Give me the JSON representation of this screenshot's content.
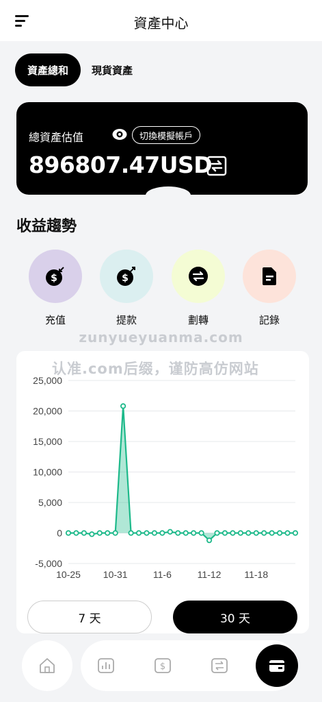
{
  "header": {
    "title": "資產中心",
    "menu_icon": "menu-icon"
  },
  "tabs": [
    {
      "label": "資產總和",
      "active": true
    },
    {
      "label": "現貨資產",
      "active": false
    }
  ],
  "asset": {
    "label": "總資產估值",
    "switch_label": "切換模擬帳戶",
    "value": "896807.47USD"
  },
  "section_title": "收益趨勢",
  "actions": [
    {
      "label": "充值",
      "icon": "deposit-icon",
      "color": "#d9d0ea"
    },
    {
      "label": "提款",
      "icon": "withdraw-icon",
      "color": "#dbeff0"
    },
    {
      "label": "劃轉",
      "icon": "transfer-icon",
      "color": "#f4fcd4"
    },
    {
      "label": "記錄",
      "icon": "record-icon",
      "color": "#fde3da"
    }
  ],
  "watermarks": {
    "site": "zunyueyuanma.com",
    "notice": "认准.com后缀，谨防高仿网站"
  },
  "chart_data": {
    "type": "line",
    "title": "",
    "xlabel": "",
    "ylabel": "",
    "ylim": [
      -5000,
      25000
    ],
    "yticks": [
      "25,000",
      "20,000",
      "15,000",
      "10,000",
      "5,000",
      "0",
      "-5,000"
    ],
    "x_tick_labels": [
      "10-25",
      "10-31",
      "11-6",
      "11-12",
      "11-18"
    ],
    "x": [
      "10-25",
      "10-26",
      "10-27",
      "10-28",
      "10-29",
      "10-30",
      "10-31",
      "11-1",
      "11-2",
      "11-3",
      "11-4",
      "11-5",
      "11-6",
      "11-7",
      "11-8",
      "11-9",
      "11-10",
      "11-11",
      "11-12",
      "11-13",
      "11-14",
      "11-15",
      "11-16",
      "11-17",
      "11-18",
      "11-19",
      "11-20",
      "11-21",
      "11-22",
      "11-23"
    ],
    "values": [
      0,
      0,
      0,
      -200,
      0,
      0,
      0,
      20800,
      0,
      0,
      0,
      0,
      0,
      200,
      0,
      0,
      0,
      0,
      -1200,
      0,
      0,
      0,
      0,
      0,
      0,
      0,
      0,
      0,
      0,
      0
    ],
    "grid": true,
    "color": "#1db98a"
  },
  "range_buttons": {
    "days7": "7 天",
    "days30": "30 天"
  },
  "nav": {
    "items": [
      "home-icon",
      "chart-icon",
      "dollar-icon",
      "exchange-icon",
      "wallet-icon"
    ]
  }
}
